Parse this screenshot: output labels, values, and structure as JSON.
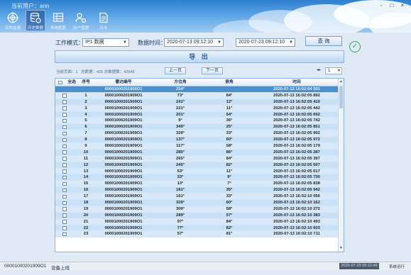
{
  "header": {
    "user_line": "当前用户：ann",
    "window_controls": [
      "-",
      "□",
      "×"
    ]
  },
  "nav": [
    {
      "label": "实时监测",
      "icon": "target-icon",
      "active": false
    },
    {
      "label": "历史数据",
      "icon": "database-icon",
      "active": true
    },
    {
      "label": "系统配置",
      "icon": "grid-settings-icon",
      "active": false
    },
    {
      "label": "用户管理",
      "icon": "user-gear-icon",
      "active": false
    },
    {
      "label": "日志",
      "icon": "document-icon",
      "active": false
    }
  ],
  "toolbar": {
    "mode_label": "工作模式：",
    "mode_value": "IP1 数据",
    "time_label": "数据时间：",
    "start_time": "2020-07-13 09:12:10",
    "end_time": "2020-07-23 09:12:10",
    "query_label": "查 询"
  },
  "export_label": "导 出",
  "stats": {
    "page_text": "当前页面：1",
    "total_text": "总数据：426 总数据数：42646"
  },
  "pager": {
    "prev_label": "上一页",
    "next_label": "下一页",
    "page_value": "1"
  },
  "table": {
    "headers": [
      "全选",
      "序号",
      "雷达编号",
      "方位角",
      "俯角",
      "时间"
    ],
    "rows": [
      {
        "idx": "",
        "radar": "00001000201909O1",
        "azimuth": "254°",
        "elev": "",
        "time": "2020-07-13 16:02:04 591"
      },
      {
        "idx": "1",
        "radar": "00001000201909O1",
        "azimuth": "73°",
        "elev": "84°",
        "time": "2020-07-13 16:02:05 892"
      },
      {
        "idx": "2",
        "radar": "00001000201909O1",
        "azimuth": "241°",
        "elev": "12°",
        "time": "2020-07-13 16:02:05 410"
      },
      {
        "idx": "3",
        "radar": "00001000201909O1",
        "azimuth": "221°",
        "elev": "11°",
        "time": "2020-07-13 16:02:05 442"
      },
      {
        "idx": "4",
        "radar": "00001000201909O1",
        "azimuth": "201°",
        "elev": "54°",
        "time": "2020-07-13 16:02:05 692"
      },
      {
        "idx": "5",
        "radar": "00001000201909O1",
        "azimuth": "9°",
        "elev": "36°",
        "time": "2020-07-13 16:02:05 742"
      },
      {
        "idx": "6",
        "radar": "00001000201909O1",
        "azimuth": "349°",
        "elev": "25°",
        "time": "2020-07-13 16:02:05 851"
      },
      {
        "idx": "7",
        "radar": "00001000201909O1",
        "azimuth": "329°",
        "elev": "33°",
        "time": "2020-07-13 16:02:05 902"
      },
      {
        "idx": "8",
        "radar": "00001000201909O1",
        "azimuth": "137°",
        "elev": "60°",
        "time": "2020-07-13 16:02:05 972"
      },
      {
        "idx": "9",
        "radar": "00001000201909O1",
        "azimuth": "117°",
        "elev": "58°",
        "time": "2020-07-13 16:02:05 179"
      },
      {
        "idx": "10",
        "radar": "00001000201909O1",
        "azimuth": "285°",
        "elev": "86°",
        "time": "2020-07-13 16:02:05 287"
      },
      {
        "idx": "11",
        "radar": "00001000201909O1",
        "azimuth": "265°",
        "elev": "84°",
        "time": "2020-07-13 16:02:05 397"
      },
      {
        "idx": "12",
        "radar": "00001000201909O1",
        "azimuth": "245°",
        "elev": "82°",
        "time": "2020-07-13 16:02:05 507"
      },
      {
        "idx": "13",
        "radar": "00001000201909O1",
        "azimuth": "53°",
        "elev": "11°",
        "time": "2020-07-13 16:02:05 617"
      },
      {
        "idx": "14",
        "radar": "00001000201909O1",
        "azimuth": "33°",
        "elev": "9°",
        "time": "2020-07-13 16:02:05 730"
      },
      {
        "idx": "15",
        "radar": "00001000201909O1",
        "azimuth": "13°",
        "elev": "7°",
        "time": "2020-07-13 16:02:05 838"
      },
      {
        "idx": "16",
        "radar": "00001000201909O1",
        "azimuth": "181°",
        "elev": "35°",
        "time": "2020-07-13 16:02:05 942"
      },
      {
        "idx": "17",
        "radar": "00001000201909O1",
        "azimuth": "161°",
        "elev": "33°",
        "time": "2020-07-13 16:02:10 056"
      },
      {
        "idx": "18",
        "radar": "00001000201909O1",
        "azimuth": "329°",
        "elev": "60°",
        "time": "2020-07-13 16:02:10 162"
      },
      {
        "idx": "19",
        "radar": "00001000201909O1",
        "azimuth": "309°",
        "elev": "58°",
        "time": "2020-07-13 16:02:10 272"
      },
      {
        "idx": "20",
        "radar": "00001000201909O1",
        "azimuth": "289°",
        "elev": "57°",
        "time": "2020-07-13 16:02:10 383"
      },
      {
        "idx": "21",
        "radar": "00001000201909O1",
        "azimuth": "97°",
        "elev": "84°",
        "time": "2020-07-13 16:02:10 493"
      },
      {
        "idx": "22",
        "radar": "00001000201909O1",
        "azimuth": "77°",
        "elev": "82°",
        "time": "2020-07-13 16:02:10 603"
      },
      {
        "idx": "23",
        "radar": "00001000201909O1",
        "azimuth": "57°",
        "elev": "81°",
        "time": "2020-07-13 16:02:10 711"
      }
    ]
  },
  "statusbar": {
    "device_id": "00001000201909O1",
    "status_text": "设备上线",
    "time": "2020-07-23 09:12:49",
    "right_text": "系统运行"
  }
}
